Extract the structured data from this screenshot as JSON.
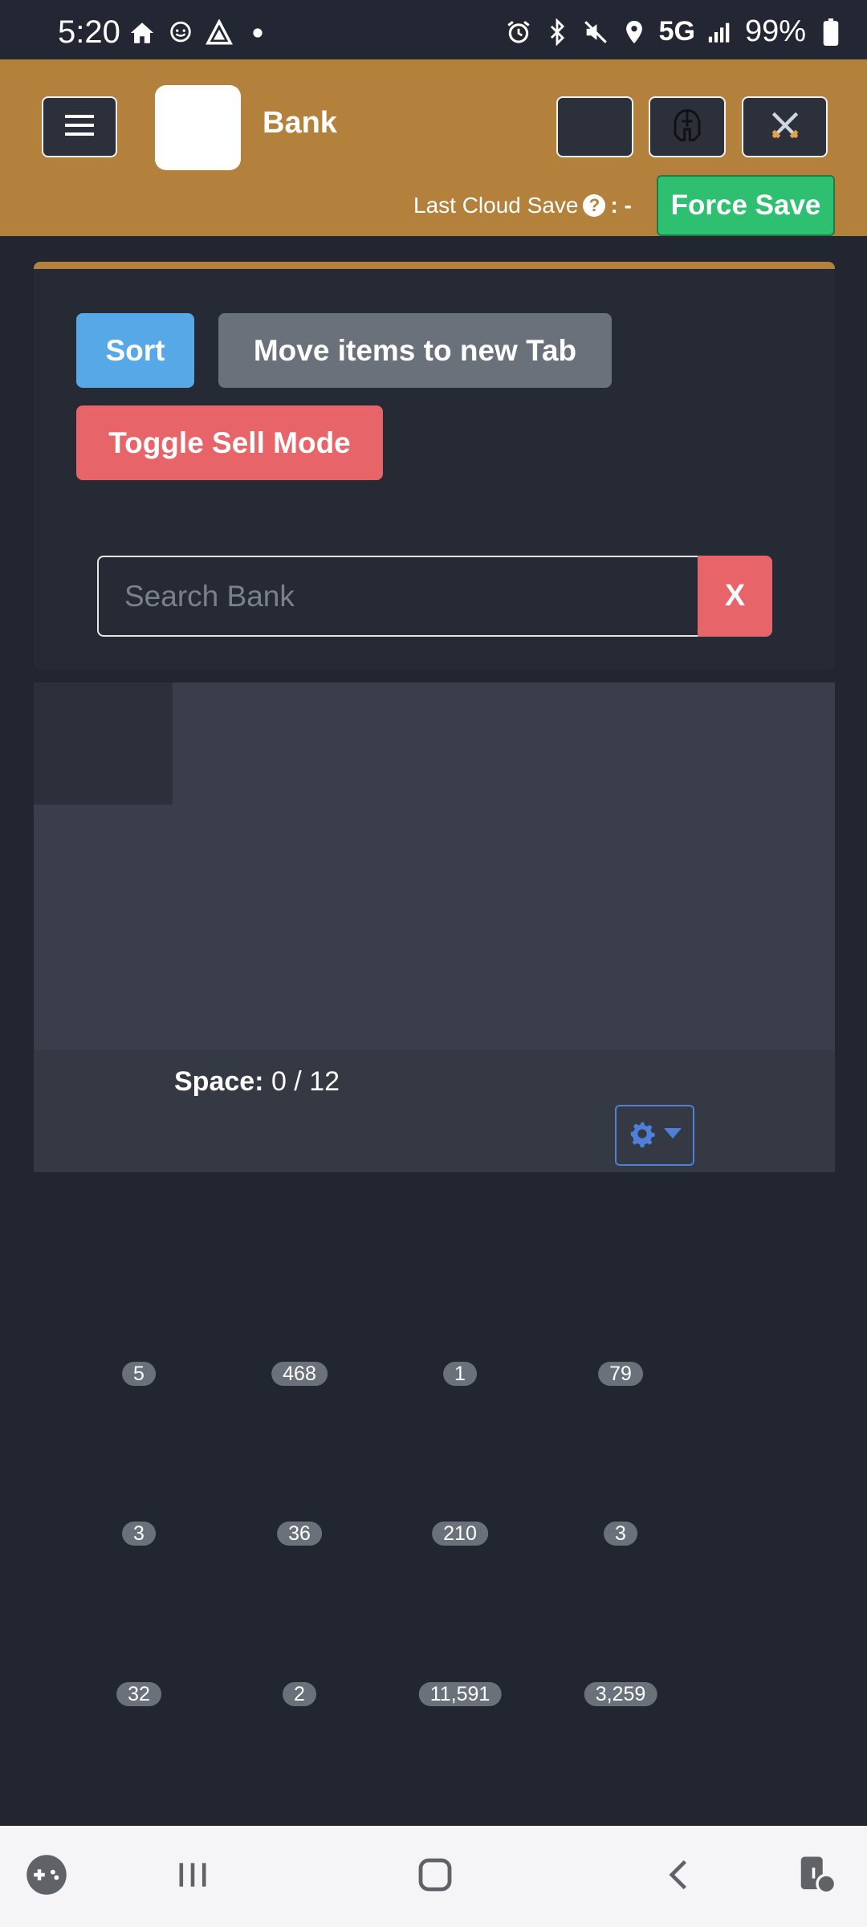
{
  "status_bar": {
    "time": "5:20",
    "network": "5G",
    "battery": "99%",
    "left_icons": [
      "home-icon",
      "waze-icon",
      "triangle-app-icon",
      "dot-icon"
    ],
    "right_icons": [
      "alarm-icon",
      "bluetooth-icon",
      "mute-icon",
      "location-icon",
      "signal-icon",
      "battery-icon"
    ]
  },
  "header": {
    "menu_icon": "hamburger-icon",
    "title": "Bank",
    "buttons": [
      "blank-button",
      "helmet-icon",
      "crossed-swords-icon"
    ],
    "last_save_label": "Last Cloud Save",
    "last_save_value": ": -",
    "force_save_label": "Force Save"
  },
  "controls": {
    "sort_label": "Sort",
    "move_label": "Move items to new Tab",
    "sell_label": "Toggle Sell Mode",
    "search_placeholder": "Search Bank",
    "clear_label": "X"
  },
  "tabs": {
    "space_label": "Space:",
    "space_value": "0 / 12"
  },
  "items": [
    {
      "qty": "5"
    },
    {
      "qty": "468"
    },
    {
      "qty": "1"
    },
    {
      "qty": "79"
    },
    {
      "qty": "3"
    },
    {
      "qty": "36"
    },
    {
      "qty": "210"
    },
    {
      "qty": "3"
    },
    {
      "qty": "32"
    },
    {
      "qty": "2"
    },
    {
      "qty": "11,591"
    },
    {
      "qty": "3,259"
    }
  ],
  "colors": {
    "header": "#b3813b",
    "sort": "#57a8e6",
    "move": "#6a717b",
    "sell": "#e76568",
    "force_save": "#2fbf71",
    "background": "#222631"
  }
}
